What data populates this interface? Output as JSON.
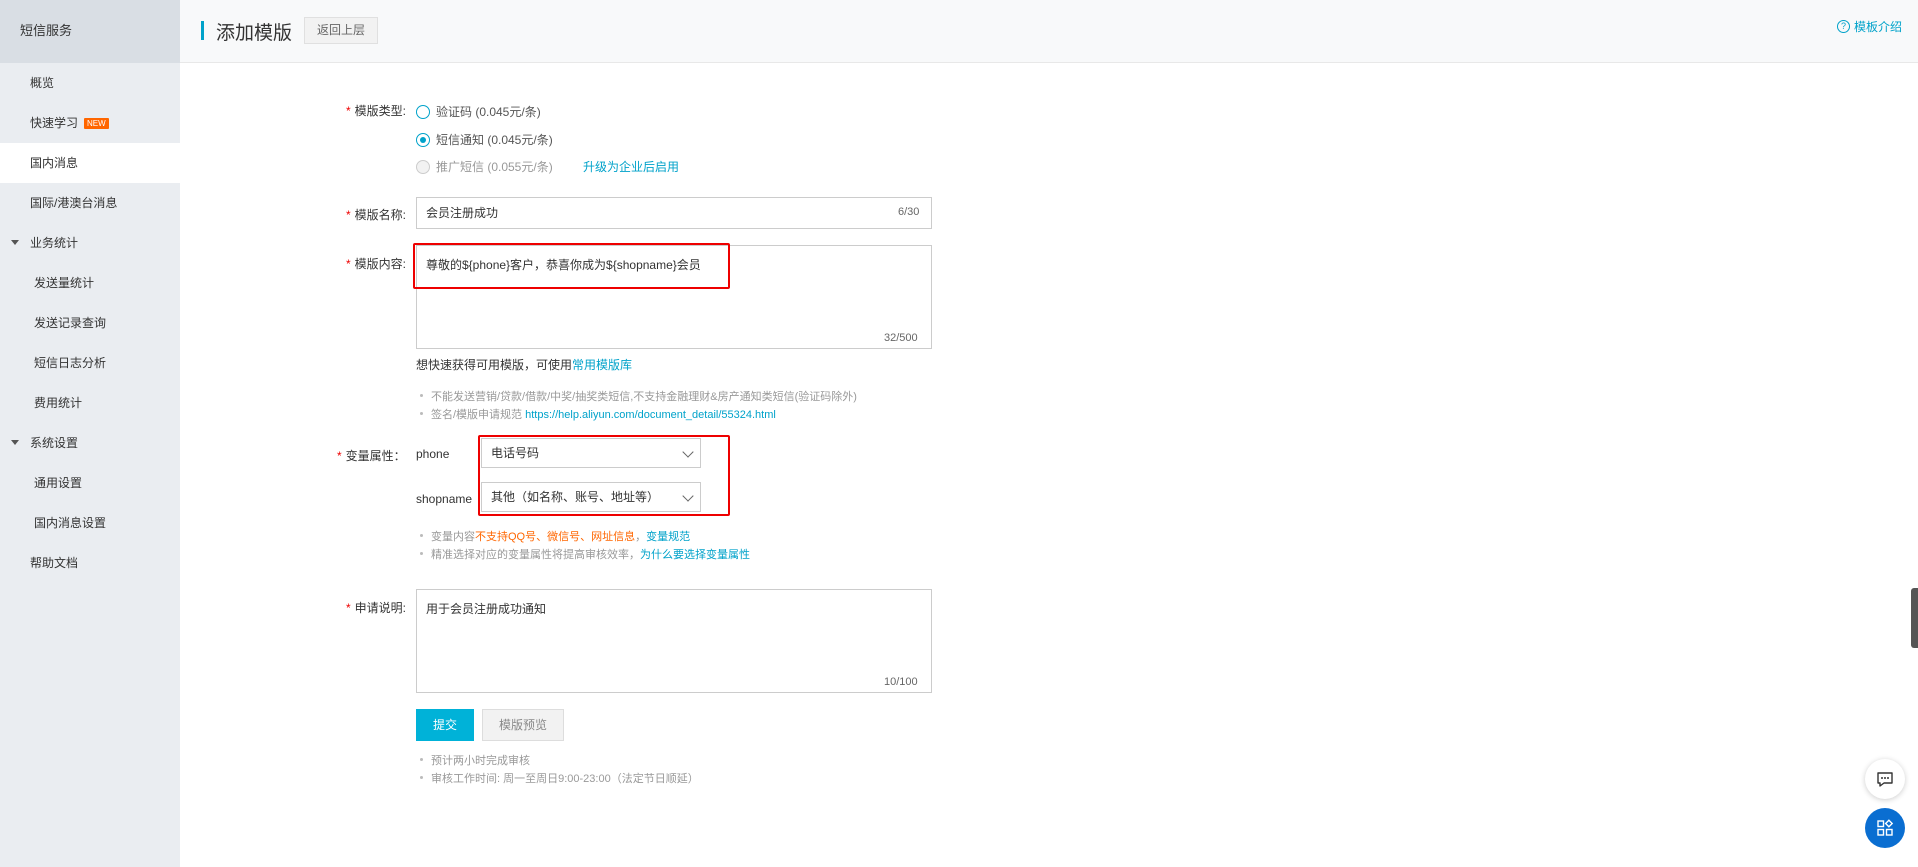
{
  "sidebar": {
    "header": "短信服务",
    "items": [
      {
        "label": "概览"
      },
      {
        "label": "快速学习",
        "badge": "NEW"
      },
      {
        "label": "国内消息"
      },
      {
        "label": "国际/港澳台消息"
      },
      {
        "label": "业务统计"
      },
      {
        "label": "发送量统计"
      },
      {
        "label": "发送记录查询"
      },
      {
        "label": "短信日志分析"
      },
      {
        "label": "费用统计"
      },
      {
        "label": "系统设置"
      },
      {
        "label": "通用设置"
      },
      {
        "label": "国内消息设置"
      },
      {
        "label": "帮助文档"
      }
    ]
  },
  "header": {
    "title": "添加模版",
    "back_label": "返回上层",
    "help_label": "模板介绍",
    "help_icon_glyph": "?"
  },
  "form": {
    "type": {
      "label": "模版类型:",
      "options": [
        {
          "label": "验证码 (0.045元/条)",
          "state": "unchecked"
        },
        {
          "label": "短信通知 (0.045元/条)",
          "state": "checked"
        },
        {
          "label": "推广短信 (0.055元/条)",
          "state": "disabled"
        }
      ],
      "upgrade_link": "升级为企业后启用"
    },
    "name": {
      "label": "模版名称:",
      "value": "会员注册成功",
      "counter": "6/30"
    },
    "content": {
      "label": "模版内容:",
      "value": "尊敬的${phone}客户，恭喜你成为${shopname}会员",
      "counter": "32/500",
      "hint_prefix": "想快速获得可用模版，可使用",
      "hint_link": "常用模版库",
      "tip1": "不能发送营销/贷款/借款/中奖/抽奖类短信,不支持金融理财&房产通知类短信(验证码除外)",
      "tip2_prefix": "签名/模版申请规范",
      "tip2_link": "https://help.aliyun.com/document_detail/55324.html"
    },
    "variables": {
      "label": "变量属性：",
      "items": [
        {
          "name": "phone",
          "selected": "电话号码"
        },
        {
          "name": "shopname",
          "selected": "其他（如名称、账号、地址等）"
        }
      ],
      "tip1_prefix": "变量内容",
      "tip1_warning": "不支持QQ号、微信号、网址信息",
      "tip1_sep": "，",
      "tip1_link": "变量规范",
      "tip2_prefix": "精准选择对应的变量属性将提高审核效率，",
      "tip2_link": "为什么要选择变量属性"
    },
    "description": {
      "label": "申请说明:",
      "value": "用于会员注册成功通知",
      "counter": "10/100"
    },
    "submit_label": "提交",
    "preview_label": "模版预览",
    "footer_tip1": "预计两小时完成审核",
    "footer_tip2": "审核工作时间: 周一至周日9:00-23:00（法定节日顺延）"
  },
  "colors": {
    "accent": "#00a2ca",
    "primary_button": "#00b2d8",
    "highlight_box": "#e00000",
    "warning_text": "#ff6600"
  },
  "icons": {
    "chat": "chat-bubble-icon",
    "apps": "apps-grid-icon"
  }
}
